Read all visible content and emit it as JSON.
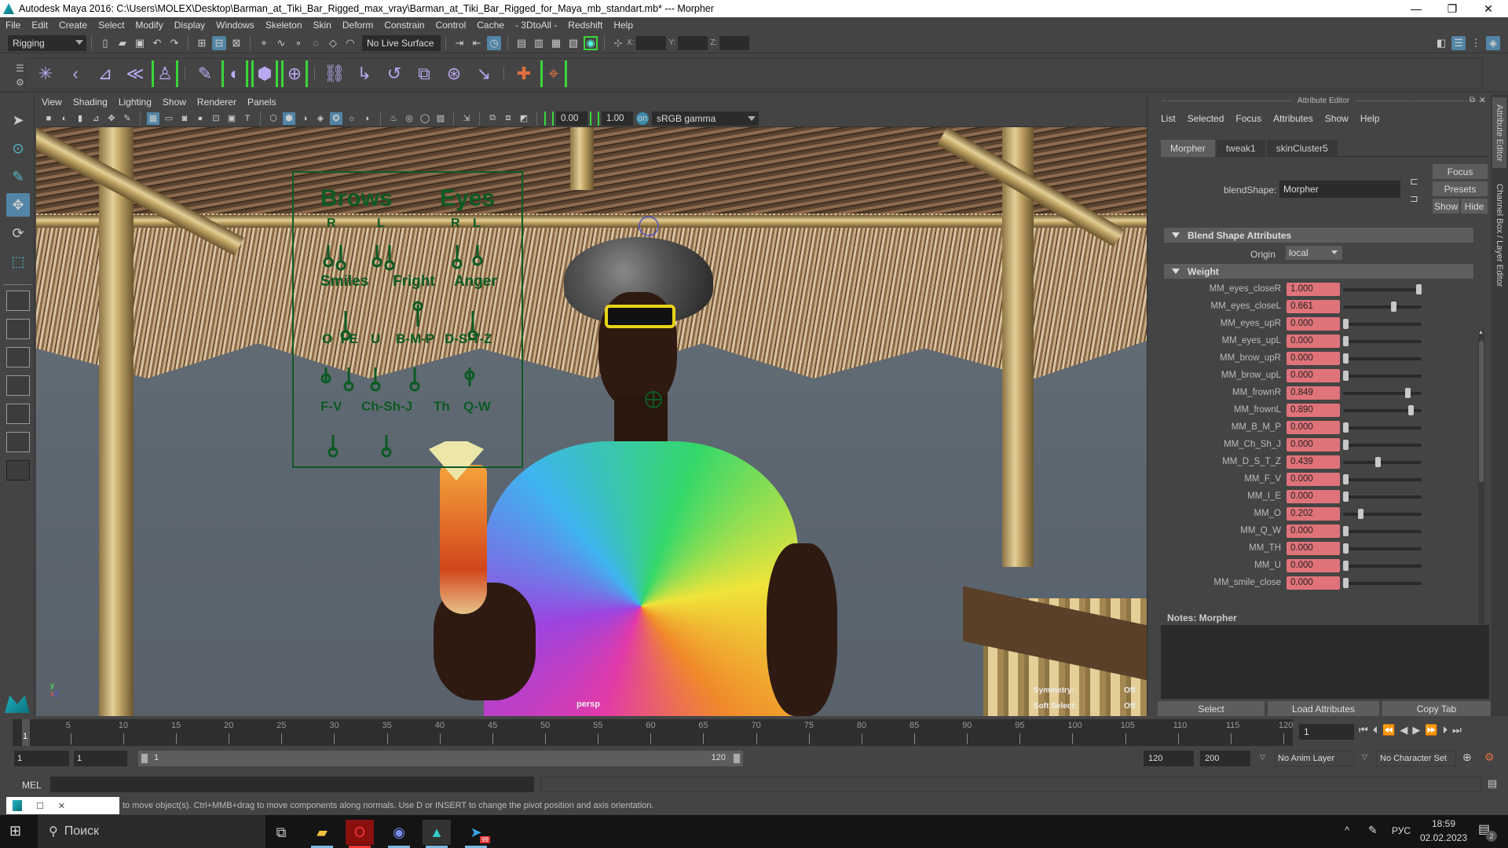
{
  "window": {
    "title": "Autodesk Maya 2016: C:\\Users\\MOLEX\\Desktop\\Barman_at_Tiki_Bar_Rigged_max_vray\\Barman_at_Tiki_Bar_Rigged_for_Maya_mb_standart.mb*  ---  Morpher",
    "controls": {
      "minimize": "—",
      "maximize": "❐",
      "close": "✕"
    }
  },
  "menubar": [
    "File",
    "Edit",
    "Create",
    "Select",
    "Modify",
    "Display",
    "Windows",
    "Skeleton",
    "Skin",
    "Deform",
    "Constrain",
    "Control",
    "Cache",
    "- 3DtoAll -",
    "Redshift",
    "Help"
  ],
  "statusline": {
    "menuset": "Rigging",
    "live_surface": "No Live Surface",
    "xyz_labels": [
      "X:",
      "Y:",
      "Z:"
    ]
  },
  "shelf": {
    "icons": [
      "joint-tool",
      "ik-handle",
      "ik-spline",
      "insert-joint",
      "hik-character",
      "paint-weights",
      "blend-shape",
      "lattice",
      "cluster",
      "parent-constraint",
      "point-constraint",
      "orient-constraint",
      "scale-constraint",
      "aim-constraint",
      "pole-vector-constraint",
      "locator",
      "bracket-locator"
    ]
  },
  "toolbox": {
    "tools": [
      "select",
      "lasso-select",
      "paint-select",
      "move",
      "rotate",
      "scale"
    ],
    "active": "move"
  },
  "viewport": {
    "menu": [
      "View",
      "Shading",
      "Lighting",
      "Show",
      "Renderer",
      "Panels"
    ],
    "near_value": "0.00",
    "far_value": "1.00",
    "color_space": "sRGB gamma",
    "camera_label": "persp",
    "hud": {
      "symmetry_label": "Symmetry:",
      "symmetry_value": "Off",
      "soft_select_label": "Soft Select:",
      "soft_select_value": "Off"
    },
    "rig_panel": {
      "headers": [
        "Brows",
        "Eyes"
      ],
      "brows_sides": [
        "R",
        "L"
      ],
      "eyes_sides": [
        "R",
        "L"
      ],
      "row2": [
        "Smiles",
        "Fright",
        "Anger"
      ],
      "row3": [
        "O",
        "I-E",
        "U",
        "B-M-P",
        "D-S-T-Z"
      ],
      "row4": [
        "F-V",
        "Ch-Sh-J",
        "Th",
        "Q-W"
      ]
    },
    "accent_green": "#0c5a24"
  },
  "attribute_editor": {
    "title": "Attribute Editor",
    "menu": [
      "List",
      "Selected",
      "Focus",
      "Attributes",
      "Show",
      "Help"
    ],
    "tabs": [
      {
        "label": "Morpher",
        "active": true
      },
      {
        "label": "tweak1",
        "active": false
      },
      {
        "label": "skinCluster5",
        "active": false
      }
    ],
    "blendshape_label": "blendShape:",
    "blendshape_value": "Morpher",
    "buttons": {
      "focus": "Focus",
      "presets": "Presets",
      "show": "Show",
      "hide": "Hide"
    },
    "section_blend": "Blend Shape Attributes",
    "origin_label": "Origin",
    "origin_value": "local",
    "section_weight": "Weight",
    "weights": [
      {
        "name": "MM_eyes_closeR",
        "value": "1.000",
        "fraction": 1.0
      },
      {
        "name": "MM_eyes_closeL",
        "value": "0.661",
        "fraction": 0.661
      },
      {
        "name": "MM_eyes_upR",
        "value": "0.000",
        "fraction": 0
      },
      {
        "name": "MM_eyes_upL",
        "value": "0.000",
        "fraction": 0
      },
      {
        "name": "MM_brow_upR",
        "value": "0.000",
        "fraction": 0
      },
      {
        "name": "MM_brow_upL",
        "value": "0.000",
        "fraction": 0
      },
      {
        "name": "MM_frownR",
        "value": "0.849",
        "fraction": 0.849
      },
      {
        "name": "MM_frownL",
        "value": "0.890",
        "fraction": 0.89
      },
      {
        "name": "MM_B_M_P",
        "value": "0.000",
        "fraction": 0
      },
      {
        "name": "MM_Ch_Sh_J",
        "value": "0.000",
        "fraction": 0
      },
      {
        "name": "MM_D_S_T_Z",
        "value": "0.439",
        "fraction": 0.439
      },
      {
        "name": "MM_F_V",
        "value": "0.000",
        "fraction": 0
      },
      {
        "name": "MM_I_E",
        "value": "0.000",
        "fraction": 0
      },
      {
        "name": "MM_O",
        "value": "0.202",
        "fraction": 0.202
      },
      {
        "name": "MM_Q_W",
        "value": "0.000",
        "fraction": 0
      },
      {
        "name": "MM_TH",
        "value": "0.000",
        "fraction": 0
      },
      {
        "name": "MM_U",
        "value": "0.000",
        "fraction": 0
      },
      {
        "name": "MM_smile_close",
        "value": "0.000",
        "fraction": 0
      }
    ],
    "value_color": "#e0737a",
    "notes_label": "Notes:  Morpher",
    "bottom_buttons": [
      "Select",
      "Load Attributes",
      "Copy Tab"
    ],
    "side_tabs": [
      "Attribute Editor",
      "Channel Box / Layer Editor"
    ]
  },
  "timeline": {
    "ticks": [
      5,
      10,
      15,
      20,
      25,
      30,
      35,
      40,
      45,
      50,
      55,
      60,
      65,
      70,
      75,
      80,
      85,
      90,
      95,
      100,
      105,
      110,
      115,
      120
    ],
    "current_frame_marker": "1",
    "current_frame": "1"
  },
  "range": {
    "start": "1",
    "playback_start": "1",
    "slider_start": "1",
    "slider_end": "120",
    "playback_end": "120",
    "end": "200",
    "anim_layer": "No Anim Layer",
    "character_set": "No Character Set"
  },
  "command_line": {
    "label": "MEL"
  },
  "help_line": "to move object(s). Ctrl+MMB+drag to move components along normals. Use D or INSERT to change the pivot position and axis orientation.",
  "taskbar": {
    "search_placeholder": "Поиск",
    "language": "РУС",
    "time": "18:59",
    "date": "02.02.2023",
    "notification_count": "2",
    "telegram_badge": "99"
  }
}
